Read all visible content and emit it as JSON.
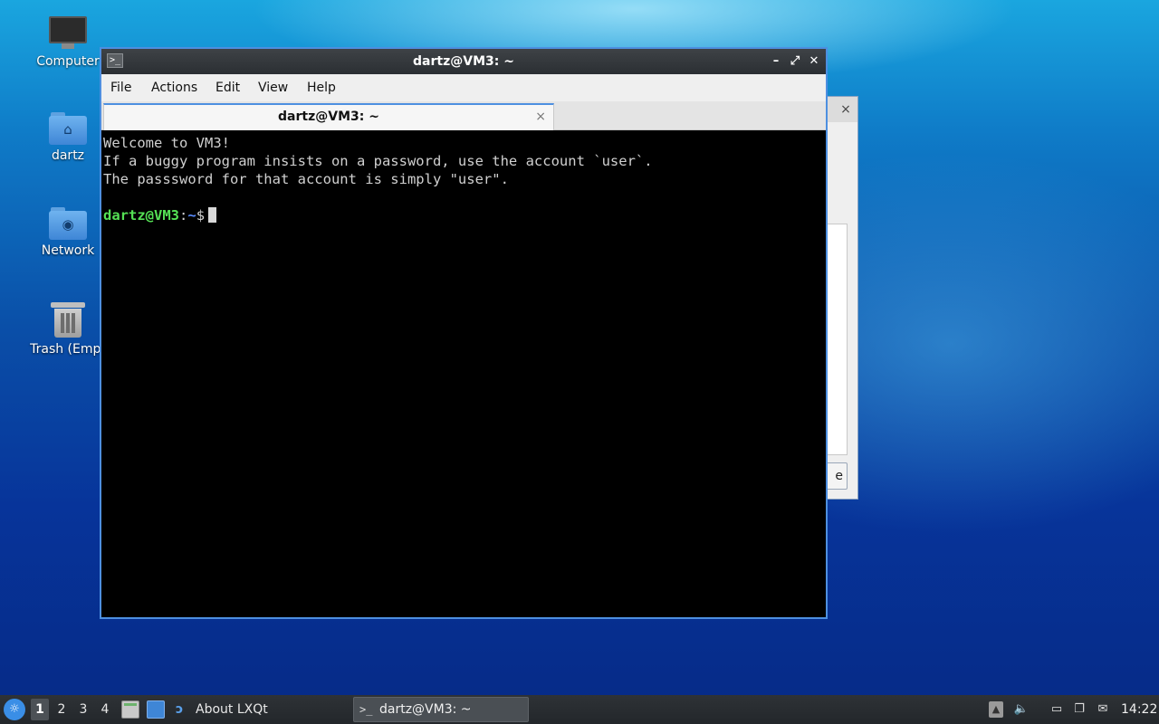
{
  "desktop": {
    "icons": [
      {
        "label": "Computer",
        "icon": "computer-icon"
      },
      {
        "label": "dartz",
        "icon": "home-folder-icon"
      },
      {
        "label": "Network",
        "icon": "network-folder-icon"
      },
      {
        "label": "Trash (Empt",
        "icon": "trash-icon"
      }
    ],
    "background_dialog": {
      "button_partial": "e",
      "close": "×"
    }
  },
  "terminal": {
    "title": "dartz@VM3: ~",
    "menu": [
      "File",
      "Actions",
      "Edit",
      "View",
      "Help"
    ],
    "tab": {
      "label": "dartz@VM3: ~",
      "close": "×"
    },
    "lines": [
      "Welcome to VM3!",
      "If a buggy program insists on a password, use the account `user`.",
      "The passsword for that account is simply \"user\"."
    ],
    "prompt": {
      "user_host": "dartz@VM3",
      "sep": ":",
      "path": "~",
      "symbol": "$"
    },
    "colors": {
      "prompt_user": "#55e155",
      "prompt_path": "#5a8cff",
      "border": "#4d8fe0"
    }
  },
  "taskbar": {
    "workspaces": [
      "1",
      "2",
      "3",
      "4"
    ],
    "active_workspace": "1",
    "about_label": "About LXQt",
    "task_label": "dartz@VM3: ~",
    "clock": "14:22"
  }
}
